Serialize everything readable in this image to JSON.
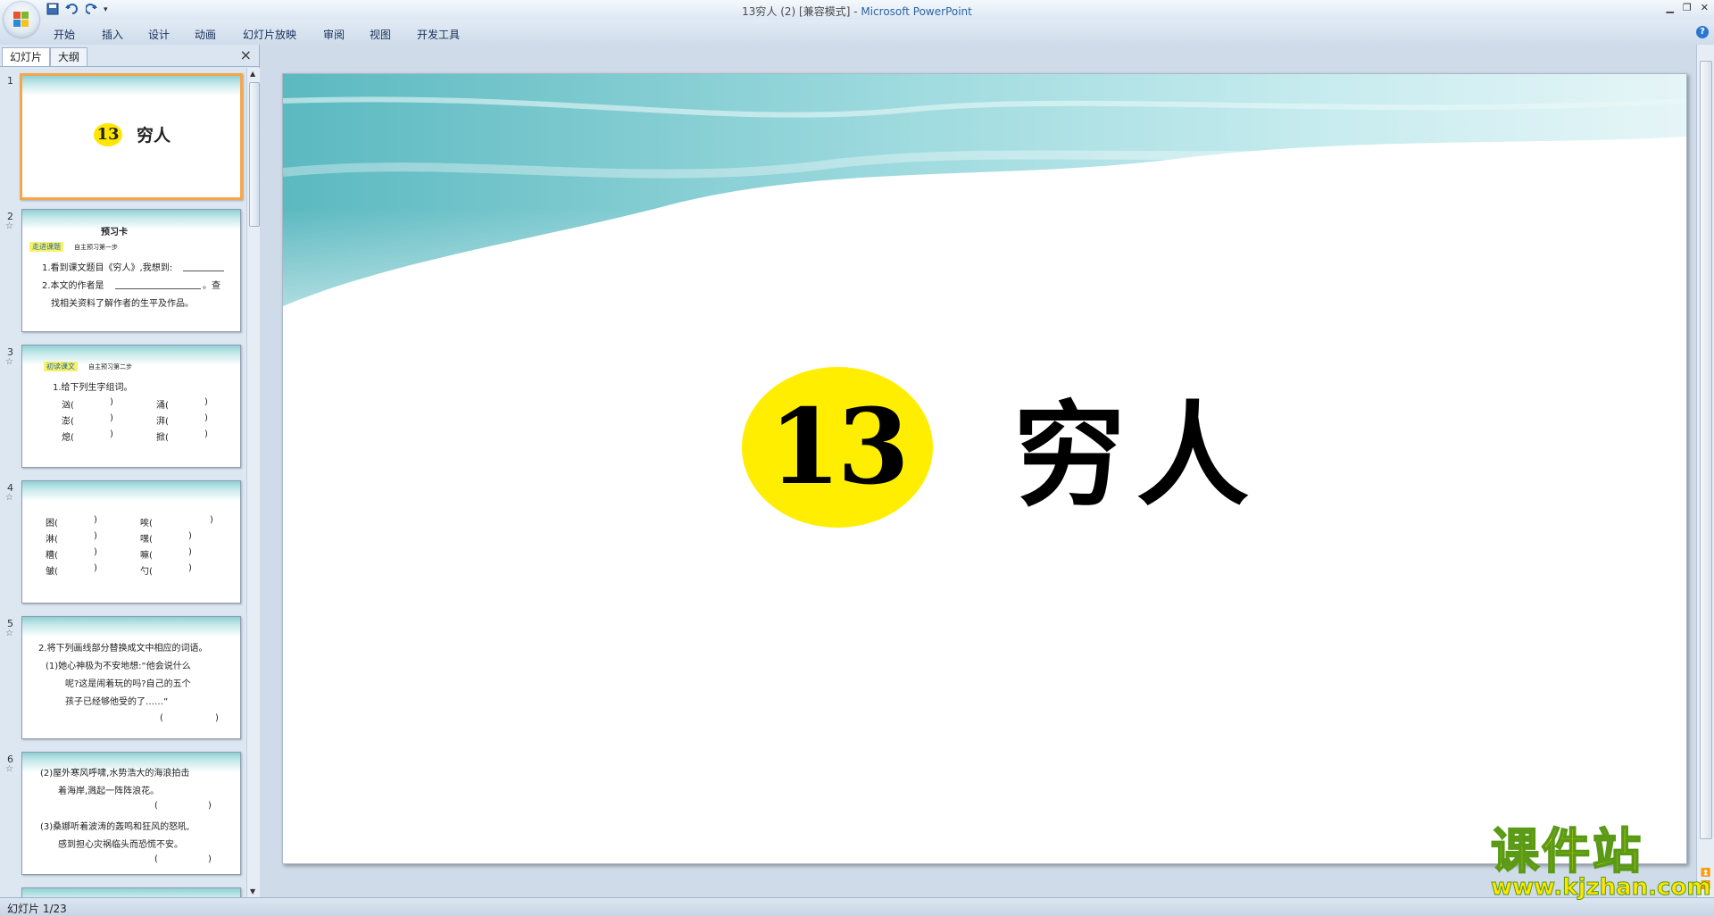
{
  "window": {
    "title": "13穷人 (2) [兼容模式]",
    "separator": " - ",
    "app_name": "Microsoft PowerPoint"
  },
  "quick_access": [
    "save-icon",
    "undo-icon",
    "redo-icon",
    "customize-icon"
  ],
  "ribbon_tabs": [
    "开始",
    "插入",
    "设计",
    "动画",
    "幻灯片放映",
    "审阅",
    "视图",
    "开发工具"
  ],
  "panel": {
    "tabs": [
      "幻灯片",
      "大纲"
    ],
    "close": "×"
  },
  "slides": [
    {
      "num": "1",
      "title_number": "13",
      "title_text": "穷人"
    },
    {
      "num": "2",
      "heading": "预习卡",
      "tag": "走进课题",
      "tag_note": "自主预习第一步",
      "lines": [
        "1.看到课文题目《穷人》,我想到:",
        "2.本文的作者是",
        "。查",
        "找相关资料了解作者的生平及作品。"
      ]
    },
    {
      "num": "3",
      "tag": "初读课文",
      "tag_note": "自主预习第二步",
      "lines": [
        "1.给下列生字组词。",
        "汹(",
        ")",
        "涌(",
        ")",
        "澎(",
        ")",
        "湃(",
        ")",
        "熄(",
        ")",
        "掀(",
        ")"
      ]
    },
    {
      "num": "4",
      "lines": [
        "困(",
        ")",
        "唉(",
        ")",
        "淋(",
        ")",
        "嘿(",
        ")",
        "糟(",
        ")",
        "嘛(",
        ")",
        "皱(",
        ")",
        "勺(",
        ")"
      ]
    },
    {
      "num": "5",
      "lines": [
        "2.将下列画线部分替换成文中相应的词语。",
        "(1)她心神极为不安地想:“他会说什么",
        "呢?这是闹着玩的吗?自己的五个",
        "孩子已经够他受的了……”",
        "(",
        ")"
      ]
    },
    {
      "num": "6",
      "lines": [
        "(2)屋外寒风呼啸,水势浩大的海浪拍击",
        "着海岸,溅起一阵阵浪花。",
        "(",
        ")",
        "(3)桑娜听着波涛的轰鸣和狂风的怒吼,",
        "感到担心灾祸临头而恐慌不安。",
        "(",
        ")"
      ]
    }
  ],
  "main_slide": {
    "number": "13",
    "title": "穷人"
  },
  "status": {
    "slide_counter": "幻灯片 1/23"
  },
  "watermark": {
    "cn": "课件站",
    "url": "www.kjzhan.com"
  },
  "colors": {
    "accent_yellow": "#ffee00",
    "selection_orange": "#f6a64a",
    "teal_wave": "#8fd0d4"
  }
}
